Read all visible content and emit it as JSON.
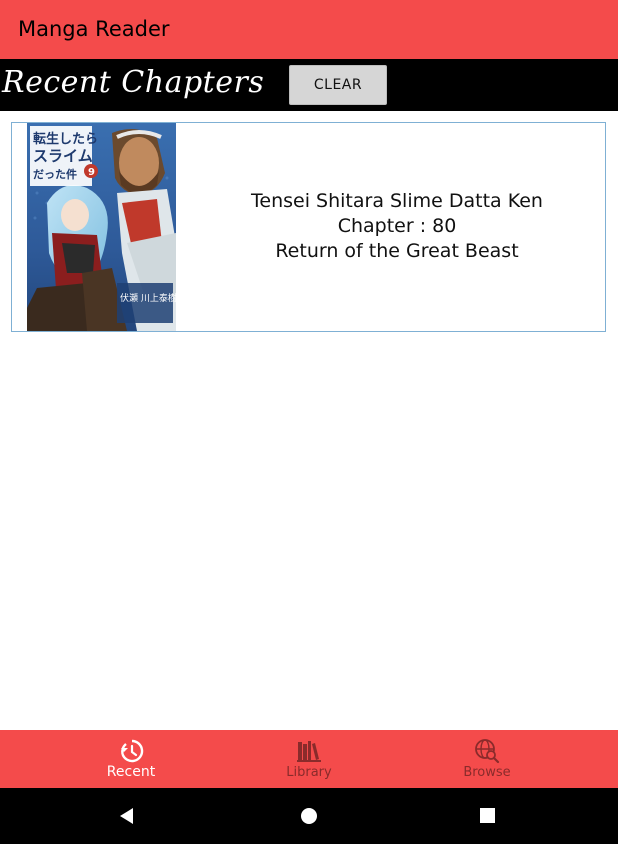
{
  "appbar": {
    "title": "Manga Reader"
  },
  "header": {
    "section_title": "Recent Chapters",
    "clear_label": "CLEAR"
  },
  "recent": [
    {
      "title": "Tensei Shitara Slime Datta Ken",
      "chapter": "Chapter : 80",
      "chapter_name": "Return of the Great Beast",
      "cover_text": {
        "top": "転生したら",
        "middle": "スライム",
        "bottom": "だった件",
        "volume": "9",
        "authors": "伏瀬 川上泰樹"
      }
    }
  ],
  "bottom_nav": {
    "items": [
      {
        "label": "Recent",
        "icon": "history-icon",
        "active": true
      },
      {
        "label": "Library",
        "icon": "library-books-icon",
        "active": false
      },
      {
        "label": "Browse",
        "icon": "globe-search-icon",
        "active": false
      }
    ]
  },
  "system_nav": {
    "back": "back-icon",
    "home": "home-icon",
    "recents": "recents-icon"
  },
  "colors": {
    "accent": "#f44b4b",
    "header_bg": "#000000",
    "card_border": "#7fb0d4",
    "nav_active": "#ffffff",
    "nav_inactive": "#8a2b2b"
  }
}
